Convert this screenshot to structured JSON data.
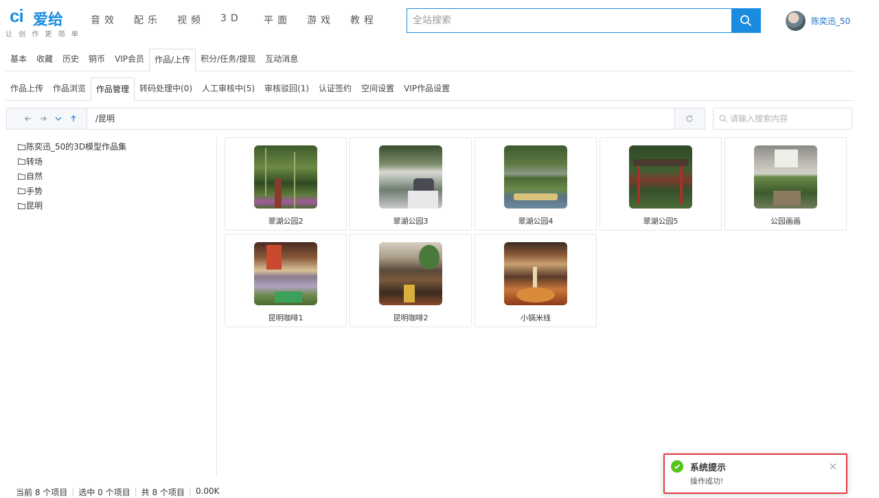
{
  "brand": {
    "name": "爱给",
    "slogan": "让 创 作 更 简 单",
    "color": "#1a8cdf"
  },
  "nav": [
    "音效",
    "配乐",
    "视频",
    "3D",
    "平面",
    "游戏",
    "教程"
  ],
  "search": {
    "placeholder": "全站搜索"
  },
  "user": {
    "name": "陈奕迅_50"
  },
  "tabs_primary": [
    "基本",
    "收藏",
    "历史",
    "铜币",
    "VIP会员",
    "作品/上传",
    "积分/任务/提现",
    "互动消息"
  ],
  "tabs_primary_active": "作品/上传",
  "tabs_secondary": [
    "作品上传",
    "作品浏览",
    "作品管理",
    "转码处理中(0)",
    "人工审核中(5)",
    "审核驳回(1)",
    "认证签约",
    "空间设置",
    "VIP作品设置"
  ],
  "tabs_secondary_active": "作品管理",
  "path": {
    "value": "/昆明"
  },
  "file_search": {
    "placeholder": "请输入搜索内容"
  },
  "tree": [
    "陈奕迅_50的3D模型作品集",
    "转场",
    "自然",
    "手势",
    "昆明"
  ],
  "items": [
    {
      "label": "翠湖公园2",
      "icon": "photo-bamboo-park"
    },
    {
      "label": "翠湖公园3",
      "icon": "photo-lake-birds"
    },
    {
      "label": "翠湖公园4",
      "icon": "photo-lake-boats"
    },
    {
      "label": "翠湖公园5",
      "icon": "photo-pavilion"
    },
    {
      "label": "公园画画",
      "icon": "photo-painting"
    },
    {
      "label": "昆明咖啡1",
      "icon": "photo-cafe-interior"
    },
    {
      "label": "昆明咖啡2",
      "icon": "photo-cafe-books"
    },
    {
      "label": "小锅米线",
      "icon": "photo-noodles"
    }
  ],
  "status": {
    "current": "当前 8 个项目",
    "selected": "选中 0 个项目",
    "total": "共 8 个项目",
    "size": "0.00K"
  },
  "notification": {
    "title": "系统提示",
    "message": "操作成功!",
    "status_color": "#52c41a",
    "border_color": "#e0393e"
  }
}
